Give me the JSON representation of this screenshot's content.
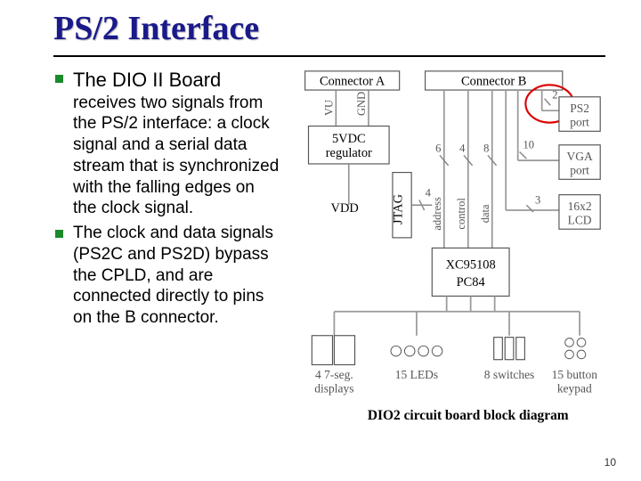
{
  "title": "PS/2 Interface",
  "bullets": [
    {
      "lead": "The DIO II Board",
      "rest": "receives two signals from the PS/2 interface: a clock signal and a serial data stream that is synchronized with the falling edges on the clock signal."
    },
    {
      "lead": "",
      "rest": "The clock and data signals (PS2C and PS2D) bypass the CPLD, and are connected directly to pins on the B connector."
    }
  ],
  "page_number": "10",
  "diagram": {
    "connA": "Connector A",
    "connB": "Connector B",
    "vu": "VU",
    "gnd": "GND",
    "reg": "5VDC regulator",
    "vdd": "VDD",
    "jtag": "JTAG",
    "n2": "2",
    "n3": "3",
    "n4": "4",
    "n6": "6",
    "n8": "8",
    "n10": "10",
    "addr": "address",
    "ctrl": "control",
    "data": "data",
    "ps2": "PS2 port",
    "vga": "VGA port",
    "lcd": "16x2 LCD",
    "chip1": "XC95108",
    "chip2": "PC84",
    "seg": "4 7-seg. displays",
    "leds": "15 LEDs",
    "sw": "8 switches",
    "kp": "15 button keypad",
    "caption": "DIO2 circuit board block diagram"
  }
}
